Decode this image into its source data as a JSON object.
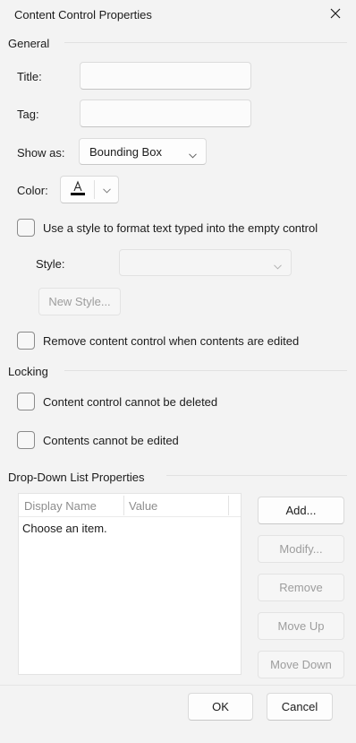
{
  "dialog": {
    "title": "Content Control Properties",
    "close_icon": "close-icon"
  },
  "general": {
    "heading": "General",
    "title_label": "Title:",
    "title_value": "",
    "tag_label": "Tag:",
    "tag_value": "",
    "show_as_label": "Show as:",
    "show_as_value": "Bounding Box",
    "color_label": "Color:",
    "use_style_label": "Use a style to format text typed into the empty control",
    "use_style_checked": false,
    "style_label": "Style:",
    "style_value": "",
    "new_style_button": "New Style...",
    "remove_cc_label": "Remove content control when contents are edited",
    "remove_cc_checked": false
  },
  "locking": {
    "heading": "Locking",
    "cannot_delete_label": "Content control cannot be deleted",
    "cannot_delete_checked": false,
    "cannot_edit_label": "Contents cannot be edited",
    "cannot_edit_checked": false
  },
  "dropdown": {
    "heading": "Drop-Down List Properties",
    "columns": [
      "Display Name",
      "Value"
    ],
    "rows": [
      {
        "display_name": "Choose an item.",
        "value": ""
      }
    ],
    "buttons": {
      "add": "Add...",
      "modify": "Modify...",
      "remove": "Remove",
      "move_up": "Move Up",
      "move_down": "Move Down"
    }
  },
  "footer": {
    "ok": "OK",
    "cancel": "Cancel"
  },
  "colors": {
    "background": "#f3f3f3",
    "text": "#1b1b1b",
    "disabled_text": "#9d9d9d",
    "color_swatch": "#000000"
  }
}
